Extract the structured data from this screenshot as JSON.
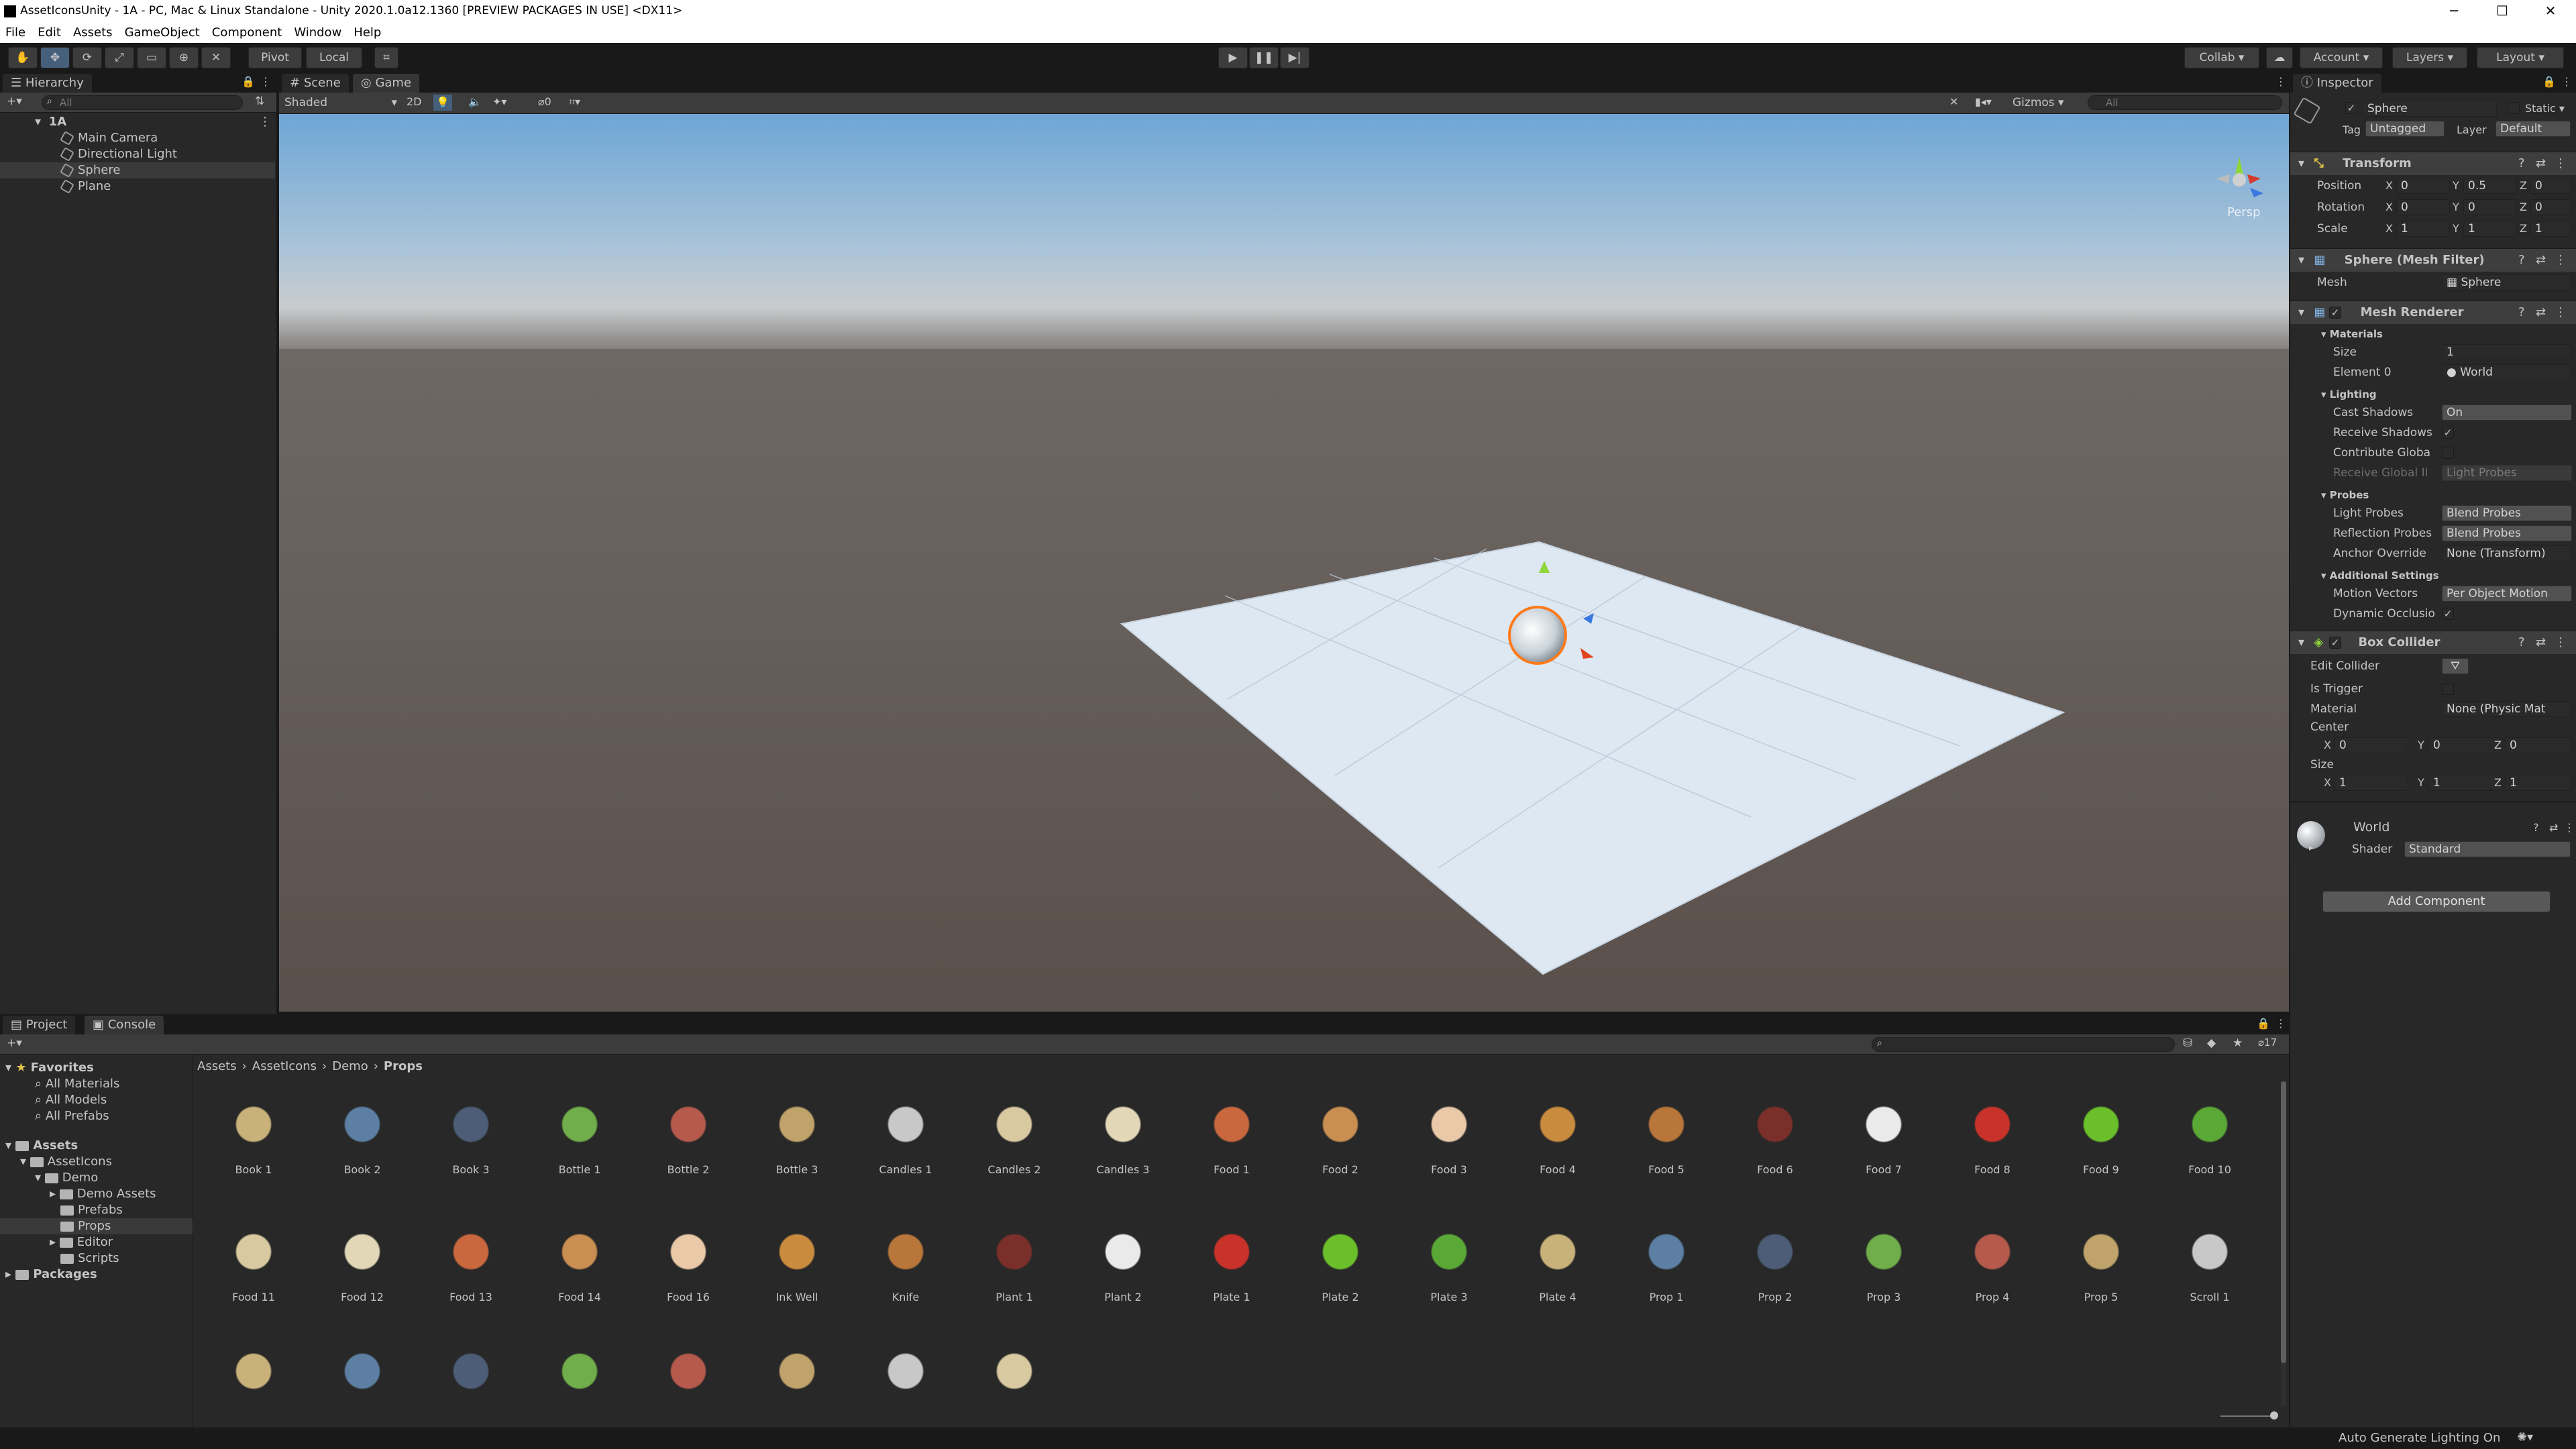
{
  "window": {
    "title": "AssetIconsUnity - 1A - PC, Mac & Linux Standalone - Unity 2020.1.0a12.1360 [PREVIEW PACKAGES IN USE] <DX11>",
    "minimize": "─",
    "maximize": "☐",
    "close": "✕"
  },
  "menu": [
    "File",
    "Edit",
    "Assets",
    "GameObject",
    "Component",
    "Window",
    "Help"
  ],
  "toolbar": {
    "pivot": "Pivot",
    "local": "Local",
    "collab": "Collab ▾",
    "account": "Account ▾",
    "layers": "Layers ▾",
    "layout": "Layout ▾"
  },
  "hierarchy": {
    "tab": "Hierarchy",
    "search_placeholder": "All",
    "scene": "1A",
    "items": [
      "Main Camera",
      "Directional Light",
      "Sphere",
      "Plane"
    ],
    "selected": "Sphere"
  },
  "scene": {
    "tab_scene": "Scene",
    "tab_game": "Game",
    "shading": "Shaded",
    "mode2d": "2D",
    "hidden_count": "0",
    "gizmos": "Gizmos ▾",
    "search_placeholder": "All",
    "persp": "Persp"
  },
  "inspector": {
    "tab": "Inspector",
    "object_name": "Sphere",
    "static": "Static ▾",
    "tag_label": "Tag",
    "tag": "Untagged",
    "layer_label": "Layer",
    "layer": "Default",
    "transform": {
      "header": "Transform",
      "position_label": "Position",
      "position": [
        "0",
        "0.5",
        "0"
      ],
      "rotation_label": "Rotation",
      "rotation": [
        "0",
        "0",
        "0"
      ],
      "scale_label": "Scale",
      "scale": [
        "1",
        "1",
        "1"
      ]
    },
    "mesh_filter": {
      "header": "Sphere (Mesh Filter)",
      "mesh_label": "Mesh",
      "mesh": "Sphere"
    },
    "mesh_renderer": {
      "header": "Mesh Renderer",
      "materials": "Materials",
      "size_label": "Size",
      "size": "1",
      "element0_label": "Element 0",
      "element0": "World",
      "lighting": "Lighting",
      "cast_shadows_label": "Cast Shadows",
      "cast_shadows": "On",
      "receive_shadows_label": "Receive Shadows",
      "contribute_gi_label": "Contribute Globa",
      "receive_gi_label": "Receive Global Il",
      "receive_gi": "Light Probes",
      "probes": "Probes",
      "light_probes_label": "Light Probes",
      "light_probes": "Blend Probes",
      "reflection_probes_label": "Reflection Probes",
      "reflection_probes": "Blend Probes",
      "anchor_override_label": "Anchor Override",
      "anchor_override": "None (Transform)",
      "additional": "Additional Settings",
      "motion_vectors_label": "Motion Vectors",
      "motion_vectors": "Per Object Motion",
      "dynamic_occlusion_label": "Dynamic Occlusio"
    },
    "box_collider": {
      "header": "Box Collider",
      "edit_label": "Edit Collider",
      "trigger_label": "Is Trigger",
      "material_label": "Material",
      "material": "None (Physic Mat",
      "center_label": "Center",
      "center": [
        "0",
        "0",
        "0"
      ],
      "size_label": "Size",
      "size": [
        "1",
        "1",
        "1"
      ]
    },
    "material": {
      "name": "World",
      "shader_label": "Shader",
      "shader": "Standard"
    },
    "add_component": "Add Component"
  },
  "project": {
    "tab": "Project",
    "console_tab": "Console",
    "favorites": "Favorites",
    "fav_items": [
      "All Materials",
      "All Models",
      "All Prefabs"
    ],
    "assets": "Assets",
    "tree": [
      "AssetIcons",
      "Demo",
      "Demo Assets",
      "Prefabs",
      "Props",
      "Editor",
      "Scripts"
    ],
    "packages": "Packages",
    "breadcrumb": [
      "Assets",
      "AssetIcons",
      "Demo",
      "Props"
    ],
    "hidden_count": "17",
    "row1": [
      "Book 1",
      "Book 2",
      "Book 3",
      "Bottle 1",
      "Bottle 2",
      "Bottle 3",
      "Candles 1",
      "Candles 2",
      "Candles 3",
      "Food 1",
      "Food 2",
      "Food 3",
      "Food 4",
      "Food 5",
      "Food 6",
      "Food 7",
      "Food 8",
      "Food 9",
      "Food 10"
    ],
    "row2": [
      "Food 11",
      "Food 12",
      "Food 13",
      "Food 14",
      "Food 16",
      "Ink Well",
      "Knife",
      "Plant 1",
      "Plant 2",
      "Plate 1",
      "Plate 2",
      "Plate 3",
      "Plate 4",
      "Prop 1",
      "Prop 2",
      "Prop 3",
      "Prop 4",
      "Prop 5",
      "Scroll 1"
    ]
  },
  "status": {
    "lighting": "Auto Generate Lighting On"
  },
  "colors": {
    "accent": "#46607c",
    "selection": "#2c5d87",
    "panel": "#282828",
    "bg": "#191919"
  }
}
